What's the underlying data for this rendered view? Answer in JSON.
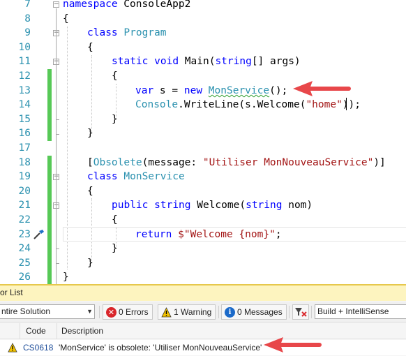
{
  "editor": {
    "line_numbers": [
      "7",
      "8",
      "9",
      "10",
      "11",
      "12",
      "13",
      "14",
      "15",
      "16",
      "17",
      "18",
      "19",
      "20",
      "21",
      "22",
      "23",
      "24",
      "25",
      "26"
    ],
    "lines": {
      "l7": {
        "kw": "namespace",
        "name": " ConsoleApp2"
      },
      "l8": {
        "text": "{"
      },
      "l9": {
        "kw": "class",
        "name": "Program"
      },
      "l10": {
        "text": "{"
      },
      "l11": {
        "kw1": "static",
        "kw2": "void",
        "name": " Main(",
        "ty": "string",
        "rest": "[] args)"
      },
      "l12": {
        "text": "{"
      },
      "l13": {
        "kw1": "var",
        "mid": " s = ",
        "kw2": "new",
        "ty": "MonService",
        "rest": "();"
      },
      "l14": {
        "ty": "Console",
        "mid": ".WriteLine(s.Welcome(",
        "str": "\"home\"",
        "rest": "));"
      },
      "l15": {
        "text": "}"
      },
      "l16": {
        "text": "}"
      },
      "l18": {
        "open": "[",
        "ty": "Obsolete",
        "mid": "(message: ",
        "str": "\"Utiliser MonNouveauService\"",
        "rest": ")]"
      },
      "l19": {
        "kw": "class",
        "ty": "MonService"
      },
      "l20": {
        "text": "{"
      },
      "l21": {
        "kw1": "public",
        "kw2": "string",
        "mid": " Welcome(",
        "kw3": "string",
        "rest": " nom)"
      },
      "l22": {
        "text": "{"
      },
      "l23": {
        "kw": "return",
        "str": "$\"Welcome {nom}\"",
        "rest": ";"
      },
      "l24": {
        "text": "}"
      },
      "l25": {
        "text": "}"
      },
      "l26": {
        "text": "}"
      }
    }
  },
  "error_list": {
    "title": "or List",
    "scope_combo": "ntire Solution",
    "errors_label": "0 Errors",
    "warnings_label": "1 Warning",
    "messages_label": "0 Messages",
    "build_combo": "Build + IntelliSense",
    "columns": {
      "code": "Code",
      "description": "Description"
    },
    "rows": [
      {
        "code": "CS0618",
        "description": "'MonService' is obsolete: 'Utiliser MonNouveauService'"
      }
    ]
  },
  "colors": {
    "keyword": "#0000ff",
    "type": "#2b91af",
    "string": "#a31515",
    "change_bar": "#57c957",
    "arrow": "#e8474a",
    "warning": "#f2c200",
    "error": "#d9262b"
  },
  "icons": [
    "fold-collapse-icon",
    "quick-action-icon",
    "error-icon",
    "warning-icon",
    "message-icon",
    "filter-icon",
    "dropdown-arrow-icon",
    "callout-arrow-icon"
  ]
}
